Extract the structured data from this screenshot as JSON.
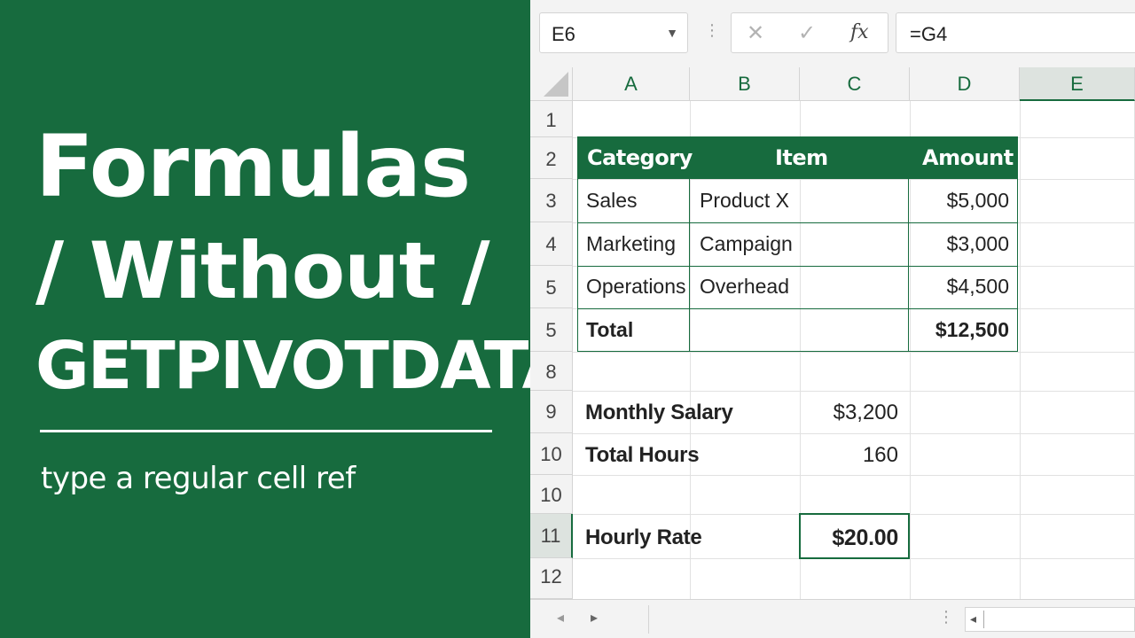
{
  "title": {
    "line1": "Formulas",
    "line2": "/ Without /",
    "line3": "GETPIVOTDATA",
    "subtitle": "type a regular cell ref"
  },
  "formula_bar": {
    "name_box": "E6",
    "formula": "=G4",
    "fx_label": "fx"
  },
  "columns": [
    "A",
    "B",
    "C",
    "D",
    "E"
  ],
  "selected_column": "E",
  "rows": [
    "1",
    "2",
    "3",
    "4",
    "5",
    "5",
    "8",
    "9",
    "10",
    "10",
    "11",
    "12"
  ],
  "selected_row": "11",
  "table": {
    "headers": [
      "Category",
      "Item",
      "Amount"
    ],
    "rows": [
      {
        "category": "Sales",
        "item": "Product X",
        "amount": "$5,000"
      },
      {
        "category": "Marketing",
        "item": "Campaign",
        "amount": "$3,000"
      },
      {
        "category": "Operations",
        "item": "Overhead",
        "amount": "$4,500"
      }
    ],
    "total_label": "Total",
    "total_amount": "$12,500"
  },
  "calc": {
    "monthly_salary_label": "Monthly Salary",
    "monthly_salary_value": "$3,200",
    "total_hours_label": "Total Hours",
    "total_hours_value": "160",
    "hourly_rate_label": "Hourly Rate",
    "hourly_rate_value": "$20.00"
  },
  "colors": {
    "brand_green": "#176b3e",
    "header_gray": "#f3f3f3"
  },
  "icons": {
    "cancel": "cancel-icon",
    "enter": "enter-icon",
    "fx": "fx-icon",
    "dropdown": "chevron-down-icon"
  }
}
